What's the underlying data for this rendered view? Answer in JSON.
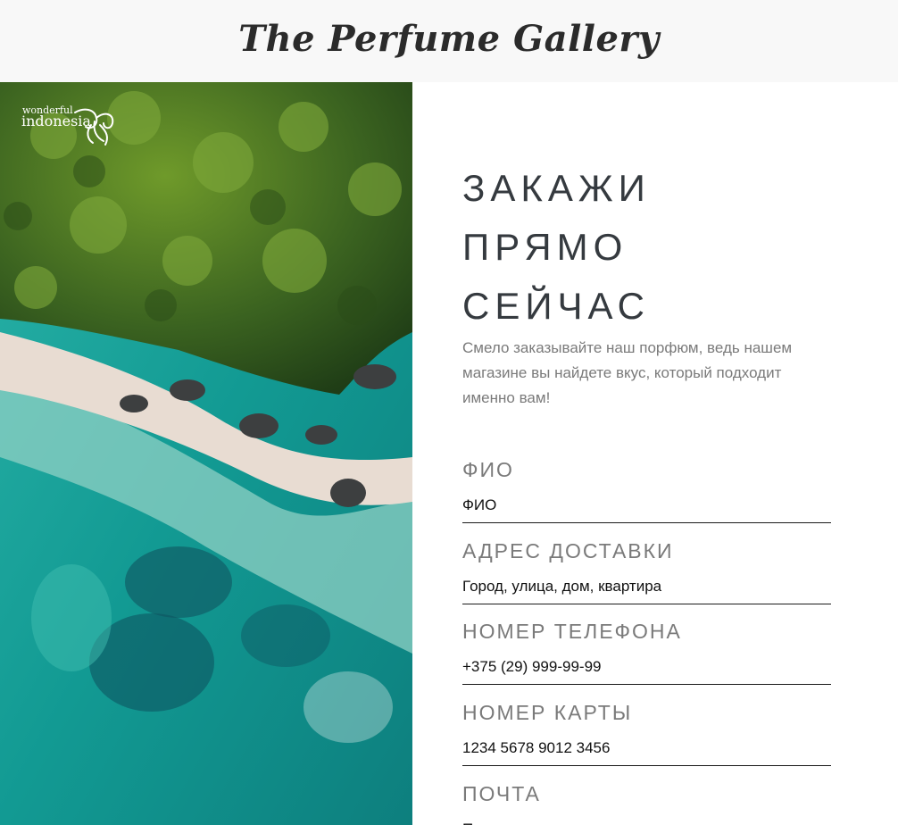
{
  "header": {
    "title": "The Perfume Gallery"
  },
  "hero": {
    "logo_small": "wonderful",
    "logo_big": "indonesia",
    "logo_icon": "bird-of-paradise-icon"
  },
  "order": {
    "heading_lines": [
      "ЗАКАЖИ",
      "ПРЯМО",
      "СЕЙЧАС"
    ],
    "lead": "Смело заказывайте наш порфюм, ведь нашем магазине вы найдете вкус, который подходит именно вам!",
    "fields": [
      {
        "label": "ФИО",
        "placeholder": "ФИО",
        "value": ""
      },
      {
        "label": "АДРЕС ДОСТАВКИ",
        "placeholder": "Город, улица, дом, квартира",
        "value": ""
      },
      {
        "label": "НОМЕР ТЕЛЕФОНА",
        "placeholder": "+375 (29) 999-99-99",
        "value": ""
      },
      {
        "label": "НОМЕР КАРТЫ",
        "placeholder": "1234 5678 9012 3456",
        "value": ""
      },
      {
        "label": "ПОЧТА",
        "placeholder": "Почта",
        "value": ""
      }
    ]
  },
  "colors": {
    "header_bg": "#f8f8f8",
    "heading": "#353a3f",
    "muted_text": "#7a7a7a",
    "sea": "#1ea39a",
    "forest": "#3f6b1c",
    "sand": "#e8dcd2"
  }
}
